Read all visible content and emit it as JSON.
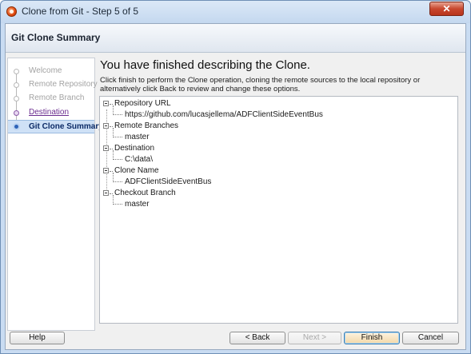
{
  "window": {
    "title": "Clone from Git - Step 5 of 5",
    "close_glyph": "✕"
  },
  "header": {
    "title": "Git Clone Summary"
  },
  "nav": {
    "items": [
      {
        "label": "Welcome",
        "state": "disabled"
      },
      {
        "label": "Remote Repository",
        "state": "disabled"
      },
      {
        "label": "Remote Branch",
        "state": "disabled"
      },
      {
        "label": "Destination",
        "state": "link"
      },
      {
        "label": "Git Clone Summary",
        "state": "active"
      }
    ]
  },
  "content": {
    "title": "You have finished describing the Clone.",
    "description": "Click finish to perform the Clone operation, cloning the remote sources to the local repository or alternatively click Back to review and change these options."
  },
  "tree": [
    {
      "label": "Repository URL",
      "value": "https://github.com/lucasjellema/ADFClientSideEventBus"
    },
    {
      "label": "Remote Branches",
      "value": "master"
    },
    {
      "label": "Destination",
      "value": "C:\\data\\"
    },
    {
      "label": "Clone Name",
      "value": "ADFClientSideEventBus"
    },
    {
      "label": "Checkout Branch",
      "value": "master"
    }
  ],
  "buttons": {
    "help": "Help",
    "back": "< Back",
    "next": "Next >",
    "finish": "Finish",
    "cancel": "Cancel"
  },
  "colors": {
    "title_bar": "#c9dcf2",
    "close_button": "#c8472e",
    "selected_step": "#cfe1f6",
    "link": "#6a2d8f"
  }
}
